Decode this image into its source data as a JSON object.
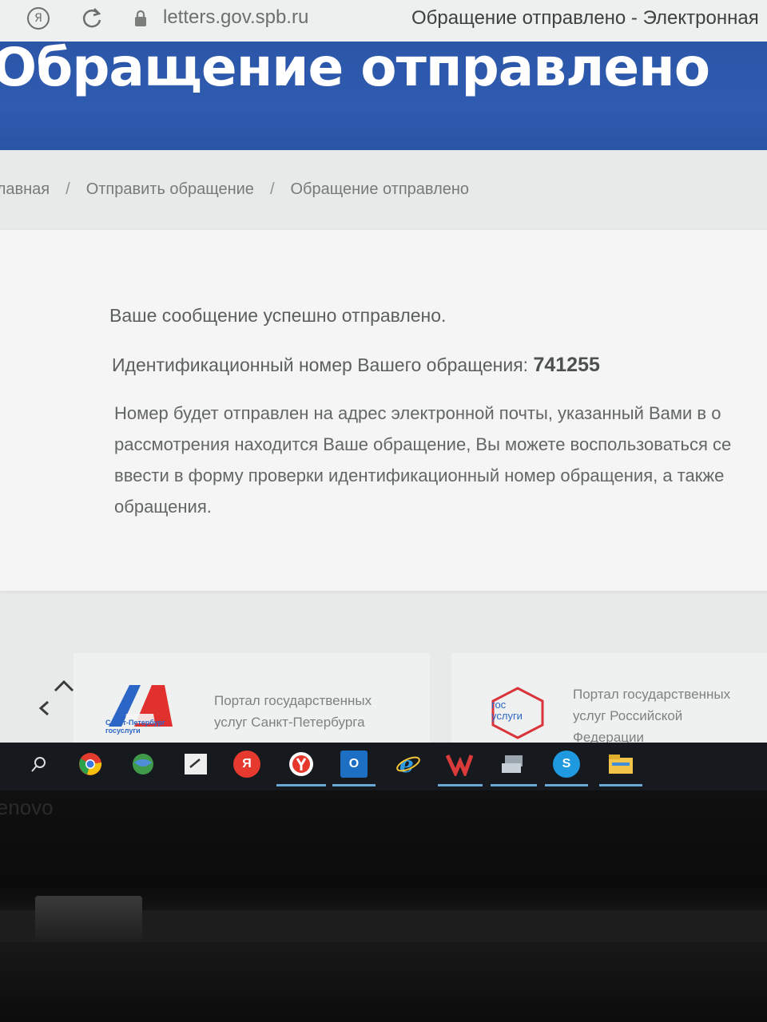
{
  "browser": {
    "url": "letters.gov.spb.ru",
    "tab_title": "Обращение отправлено - Электронная",
    "ya_letter": "Я"
  },
  "header": {
    "title": "Обращение отправлено"
  },
  "breadcrumb": {
    "items": [
      "Главная",
      "Отправить обращение",
      "Обращение отправлено"
    ],
    "separator": "/"
  },
  "content": {
    "success": "Ваше сообщение успешно отправлено.",
    "id_label": "Идентификационный номер Вашего обращения:",
    "id_number": "741255",
    "note_lines": [
      "Номер будет отправлен на адрес электронной почты, указанный Вами в о",
      "рассмотрения находится Ваше обращение, Вы можете воспользоваться се",
      "ввести в форму проверки идентификационный номер обращения, а также",
      "обращения."
    ]
  },
  "footer": {
    "spb_portal_line1": "Портал государственных",
    "spb_portal_line2": "услуг Санкт-Петербурга",
    "spb_logo_line1": "Санкт-Петербург",
    "spb_logo_line2": "госуслуги",
    "gos_portal_line1": "Портал государственных",
    "gos_portal_line2": "услуг Российской",
    "gos_portal_line3": "Федерации",
    "gos_logo_line1": "гос",
    "gos_logo_line2": "услуги"
  },
  "taskbar": {
    "items": [
      "search-icon",
      "chrome-icon",
      "network-icon",
      "notepad-icon",
      "yandex-icon",
      "yandex-browser-icon",
      "outlook-icon",
      "ie-icon",
      "viber-icon",
      "devices-icon",
      "skype-icon",
      "explorer-icon"
    ],
    "yandex_letter": "Я",
    "outlook_letter": "O",
    "skype_letter": "S"
  },
  "laptop": {
    "brand": "lenovo"
  },
  "colors": {
    "header_blue": "#2c57a9",
    "page_bg": "#e7eae8",
    "card_bg": "#f4f5f4",
    "text_gray": "#5b605d"
  }
}
